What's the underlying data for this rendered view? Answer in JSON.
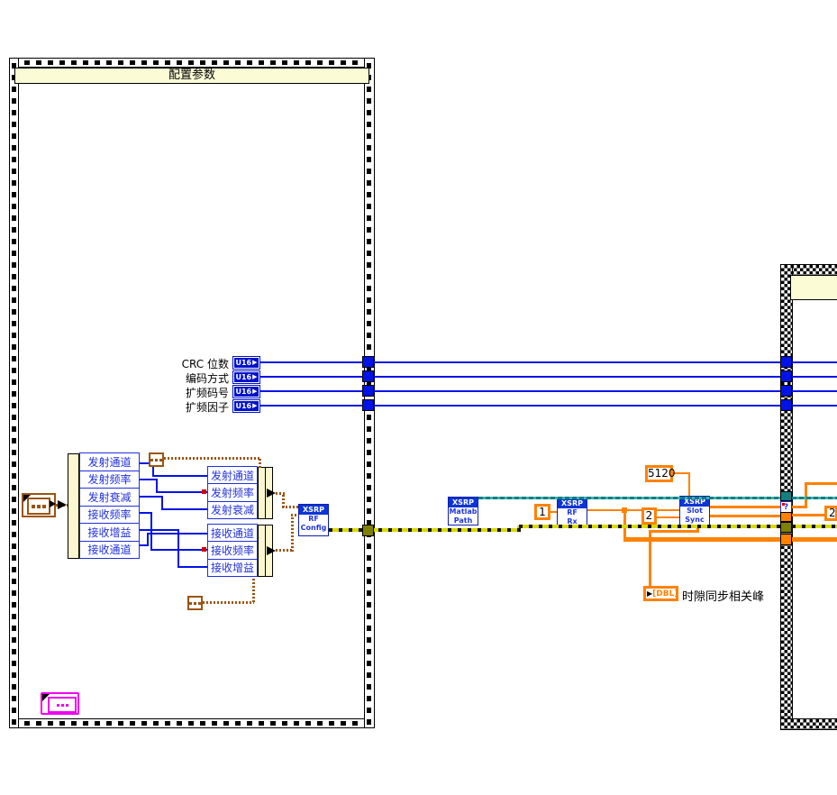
{
  "frames": {
    "config": {
      "title": "配置参数"
    },
    "right": {
      "title": ""
    }
  },
  "params": [
    {
      "label": "CRC 位数",
      "type": "U16"
    },
    {
      "label": "编码方式",
      "type": "U16"
    },
    {
      "label": "扩频码号",
      "type": "U16"
    },
    {
      "label": "扩频因子",
      "type": "U16"
    }
  ],
  "unbundle": {
    "fields": [
      "发射通道",
      "发射频率",
      "发射衰减",
      "接收频率",
      "接收增益",
      "接收通道"
    ]
  },
  "bundle_tx": {
    "fields": [
      "发射通道",
      "发射频率",
      "发射衰减"
    ]
  },
  "bundle_rx": {
    "fields": [
      "接收通道",
      "接收频率",
      "接收增益"
    ]
  },
  "vis": {
    "rf_config": {
      "header": "XSRP",
      "line1": "RF",
      "line2": "Config"
    },
    "matlab_path": {
      "header": "XSRP",
      "line1": "Matlab",
      "line2": "Path"
    },
    "rf_rx": {
      "header": "XSRP",
      "line1": "RF",
      "line2": "Rx"
    },
    "slot_sync": {
      "header": "XSRP",
      "line1": "Slot",
      "line2": "Sync"
    }
  },
  "constants": {
    "one": "1",
    "two": "2",
    "sync_len": "5120",
    "right_partial": "2"
  },
  "indicator": {
    "type_label": "[DBL]",
    "label": "时隙同步相关峰",
    "question_mark": "?"
  },
  "colors": {
    "int_blue": "#0013E6",
    "dbl_orange": "#FF8200",
    "cluster_brown": "#9C5410",
    "string_teal": "#0A7F7F",
    "error_olive": "#7F7F00",
    "banner_yellow": "#FBFBD6",
    "typedef_magenta": "#F000F0"
  }
}
